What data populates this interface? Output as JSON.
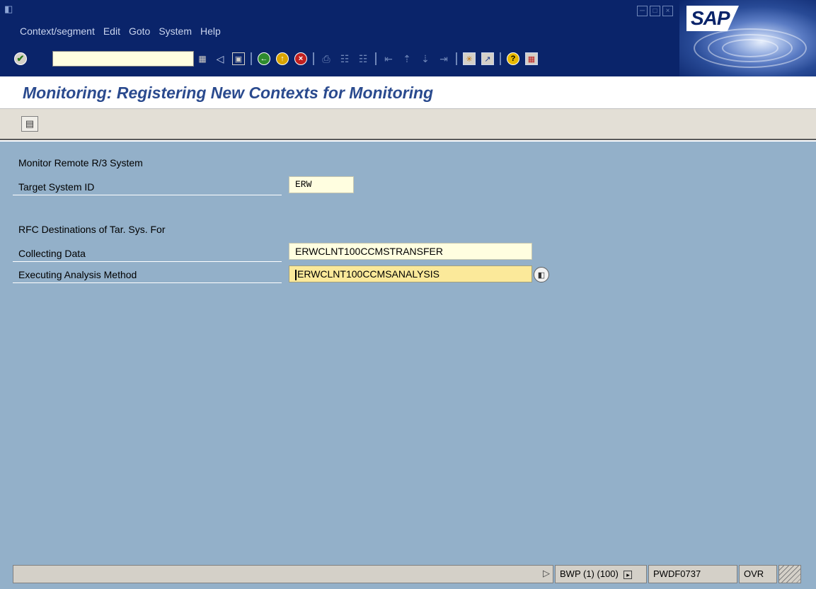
{
  "menubar": {
    "items": [
      {
        "label": "Context/segment"
      },
      {
        "label": "Edit"
      },
      {
        "label": "Goto"
      },
      {
        "label": "System"
      },
      {
        "label": "Help"
      }
    ]
  },
  "brand": {
    "logo_text": "SAP"
  },
  "toolbar": {
    "command_field_value": "",
    "icons": [
      "enter-icon",
      "command-history-icon",
      "back-arrow-icon",
      "save-icon",
      "back-icon",
      "exit-icon",
      "cancel-icon",
      "print-icon",
      "find-icon",
      "find-next-icon",
      "first-page-icon",
      "previous-page-icon",
      "next-page-icon",
      "last-page-icon",
      "create-session-icon",
      "create-shortcut-icon",
      "help-icon",
      "layout-menu-icon"
    ]
  },
  "title": "Monitoring: Registering New Contexts for Monitoring",
  "app_toolbar": {
    "icons": [
      "display-overview-icon"
    ]
  },
  "form": {
    "section1_label": "Monitor Remote R/3 System",
    "target_system_label": "Target System ID",
    "target_system_value": "ERW",
    "section2_label": "RFC Destinations of Tar. Sys. For",
    "collecting_label": "Collecting Data",
    "collecting_value": "ERWCLNT100CCMSTRANSFER",
    "analysis_label": "Executing Analysis Method",
    "analysis_value": "ERWCLNT100CCMSANALYSIS"
  },
  "statusbar": {
    "system": "BWP (1) (100)",
    "server": "PWDF0737",
    "mode": "OVR"
  },
  "colors": {
    "menubar_bg": "#0a246a",
    "content_bg": "#93b0c9",
    "field_bg": "#fffee0",
    "field_focus_bg": "#fbe99a",
    "title_color": "#2a4a8e"
  }
}
